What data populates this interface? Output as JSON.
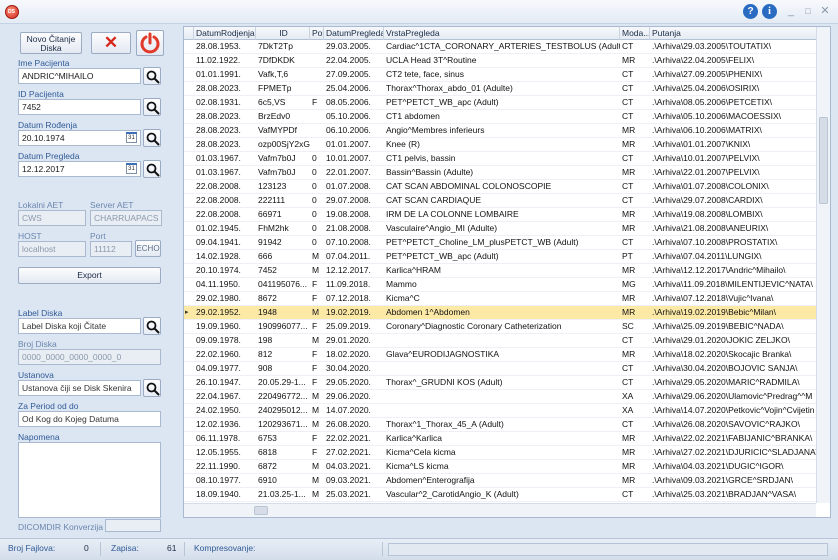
{
  "titlebar": {
    "logo_text": "DS",
    "help_label": "?",
    "info_label": "i",
    "minimize": "_",
    "maximize": "□",
    "close": "✕"
  },
  "left": {
    "new_reading_label": "Novo Čitanje\nDiska",
    "cancel_label": "✕",
    "patient_name_label": "Ime Pacijenta",
    "patient_name_value": "ANDRIC^MIHAILO",
    "patient_id_label": "ID Pacijenta",
    "patient_id_value": "7452",
    "birth_date_label": "Datum Rođenja",
    "birth_date_value": "20.10.1974",
    "exam_date_label": "Datum Pregleda",
    "exam_date_value": "12.12.2017",
    "cal_label": "31",
    "local_aet_label": "Lokalni AET",
    "server_aet_label": "Server AET",
    "local_aet_value": "CWS",
    "server_aet_value": "CHARRUAPACS",
    "host_label": "HOST",
    "port_label": "Port",
    "host_value": "localhost",
    "port_value": "11112",
    "echo_label": "ECHO",
    "export_label": "Export",
    "disk_label_label": "Label Diska",
    "disk_label_placeholder": "Label Diska koji Čitate",
    "disk_number_label": "Broj Diska",
    "disk_number_placeholder": "0000_0000_0000_0000_0",
    "institution_label": "Ustanova",
    "institution_placeholder": "Ustanova čiji se Disk Skenira",
    "period_label": "Za Period od do",
    "period_placeholder": "Od Kog do Kojeg Datuma",
    "note_label": "Napomena",
    "dicomdir_label": "DICOMDIR Konverzija"
  },
  "grid": {
    "columns": [
      "DatumRodjenja",
      "ID",
      "Pol",
      "DatumPregleda",
      "VrstaPregleda",
      "Moda...",
      "Putanja"
    ],
    "selected_index": 19,
    "selected_marker": "▸",
    "rows": [
      [
        "28.08.1953.",
        "7DkT2Tp",
        "",
        "29.03.2005.",
        "Cardiac^1CTA_CORONARY_ARTERIES_TESTBOLUS (Adult)",
        "CT",
        ".\\Arhiva\\29.03.2005\\TOUTATIX\\"
      ],
      [
        "11.02.1922.",
        "7DfDKDK",
        "",
        "22.04.2005.",
        "UCLA Head 3T^Routine",
        "MR",
        ".\\Arhiva\\22.04.2005\\FELIX\\"
      ],
      [
        "01.01.1991.",
        "Vafk,T,6",
        "",
        "27.09.2005.",
        "CT2 tete, face, sinus",
        "CT",
        ".\\Arhiva\\27.09.2005\\PHENIX\\"
      ],
      [
        "28.08.2023.",
        "FPMETp",
        "",
        "25.04.2006.",
        "Thorax^Thorax_abdo_01 (Adulte)",
        "CT",
        ".\\Arhiva\\25.04.2006\\OSIRIX\\"
      ],
      [
        "02.08.1931.",
        "6c5,VS",
        "F",
        "08.05.2006.",
        "PET^PETCT_WB_apc (Adult)",
        "CT",
        ".\\Arhiva\\08.05.2006\\PETCETIX\\"
      ],
      [
        "28.08.2023.",
        "BrzEdv0",
        "",
        "05.10.2006.",
        "CT1 abdomen",
        "CT",
        ".\\Arhiva\\05.10.2006\\MACOESSIX\\"
      ],
      [
        "28.08.2023.",
        "VafMYPDf",
        "",
        "06.10.2006.",
        "Angio^Membres inferieurs",
        "MR",
        ".\\Arhiva\\06.10.2006\\MATRIX\\"
      ],
      [
        "28.08.2023.",
        "ozp00SjY2xG",
        "",
        "01.01.2007.",
        "Knee (R)",
        "MR",
        ".\\Arhiva\\01.01.2007\\KNIX\\"
      ],
      [
        "01.03.1967.",
        "Vafm7b0J",
        "0",
        "10.01.2007.",
        "CT1 pelvis, bassin",
        "CT",
        ".\\Arhiva\\10.01.2007\\PELVIX\\"
      ],
      [
        "01.03.1967.",
        "Vafm7b0J",
        "0",
        "22.01.2007.",
        "Bassin^Bassin (Adulte)",
        "MR",
        ".\\Arhiva\\22.01.2007\\PELVIX\\"
      ],
      [
        "22.08.2008.",
        "123123",
        "0",
        "01.07.2008.",
        "CAT SCAN ABDOMINAL COLONOSCOPIE",
        "CT",
        ".\\Arhiva\\01.07.2008\\COLONIX\\"
      ],
      [
        "22.08.2008.",
        "222111",
        "0",
        "29.07.2008.",
        "CAT SCAN CARDIAQUE",
        "CT",
        ".\\Arhiva\\29.07.2008\\CARDIX\\"
      ],
      [
        "22.08.2008.",
        "66971",
        "0",
        "19.08.2008.",
        "IRM DE LA COLONNE LOMBAIRE",
        "MR",
        ".\\Arhiva\\19.08.2008\\LOMBIX\\"
      ],
      [
        "01.02.1945.",
        "FhM2hk",
        "0",
        "21.08.2008.",
        "Vasculaire^Angio_MI (Adulte)",
        "MR",
        ".\\Arhiva\\21.08.2008\\ANEURIX\\"
      ],
      [
        "09.04.1941.",
        "91942",
        "0",
        "07.10.2008.",
        "PET^PETCT_Choline_LM_plusPETCT_WB (Adult)",
        "CT",
        ".\\Arhiva\\07.10.2008\\PROSTATIX\\"
      ],
      [
        "14.02.1928.",
        "666",
        "M",
        "07.04.2011.",
        "PET^PETCT_WB_apc (Adult)",
        "PT",
        ".\\Arhiva\\07.04.2011\\LUNGIX\\"
      ],
      [
        "20.10.1974.",
        "7452",
        "M",
        "12.12.2017.",
        "Karlica^HRAM",
        "MR",
        ".\\Arhiva\\12.12.2017\\Andric^Mihailo\\"
      ],
      [
        "04.11.1950.",
        "041195076...",
        "F",
        "11.09.2018.",
        "Mammo",
        "MG",
        ".\\Arhiva\\11.09.2018\\MILENTIJEVIC^NATA\\"
      ],
      [
        "29.02.1980.",
        "8672",
        "F",
        "07.12.2018.",
        "Kicma^C",
        "MR",
        ".\\Arhiva\\07.12.2018\\Vujic^Ivana\\"
      ],
      [
        "29.02.1952.",
        "1948",
        "M",
        "19.02.2019.",
        "Abdomen 1^Abdomen",
        "MR",
        ".\\Arhiva\\19.02.2019\\Bebic^Milan\\"
      ],
      [
        "19.09.1960.",
        "190996077...",
        "F",
        "25.09.2019.",
        "Coronary^Diagnostic Coronary Catheterization",
        "SC",
        ".\\Arhiva\\25.09.2019\\BEBIC^NADA\\"
      ],
      [
        "09.09.1978.",
        "198",
        "M",
        "29.01.2020.",
        "",
        "CT",
        ".\\Arhiva\\29.01.2020\\JOKIC ZELJKO\\"
      ],
      [
        "22.02.1960.",
        "812",
        "F",
        "18.02.2020.",
        "Glava^EURODIJAGNOSTIKA",
        "MR",
        ".\\Arhiva\\18.02.2020\\Skocajic Branka\\"
      ],
      [
        "04.09.1977.",
        "908",
        "F",
        "30.04.2020.",
        "",
        "CT",
        ".\\Arhiva\\30.04.2020\\BOJOVIC SANJA\\"
      ],
      [
        "26.10.1947.",
        "20.05.29-1...",
        "F",
        "29.05.2020.",
        "Thorax^_GRUDNI KOS (Adult)",
        "CT",
        ".\\Arhiva\\29.05.2020\\MARIC^RADMILA\\"
      ],
      [
        "22.04.1967.",
        "220496772...",
        "M",
        "29.06.2020.",
        "",
        "XA",
        ".\\Arhiva\\29.06.2020\\Ulamovic^Predrag^^M"
      ],
      [
        "24.02.1950.",
        "240295012...",
        "M",
        "14.07.2020.",
        "",
        "XA",
        ".\\Arhiva\\14.07.2020\\Petkovic^Vojin^Cvijetin"
      ],
      [
        "12.02.1936.",
        "120293671...",
        "M",
        "26.08.2020.",
        "Thorax^1_Thorax_45_A (Adult)",
        "CT",
        ".\\Arhiva\\26.08.2020\\SAVOVIC^RAJKO\\"
      ],
      [
        "06.11.1978.",
        "6753",
        "F",
        "22.02.2021.",
        "Karlica^Karlica",
        "MR",
        ".\\Arhiva\\22.02.2021\\FABIJANIC^BRANKA\\"
      ],
      [
        "12.05.1955.",
        "6818",
        "F",
        "27.02.2021.",
        "Kicma^Cela kicma",
        "MR",
        ".\\Arhiva\\27.02.2021\\DJURICIC^SLADJANA\\"
      ],
      [
        "22.11.1990.",
        "6872",
        "M",
        "04.03.2021.",
        "Kicma^LS kicma",
        "MR",
        ".\\Arhiva\\04.03.2021\\DUGIC^IGOR\\"
      ],
      [
        "08.10.1977.",
        "6910",
        "M",
        "09.03.2021.",
        "Abdomen^Enterografija",
        "MR",
        ".\\Arhiva\\09.03.2021\\GRCE^SRDJAN\\"
      ],
      [
        "18.09.1940.",
        "21.03.25-1...",
        "M",
        "25.03.2021.",
        "Vascular^2_CarotidAngio_K (Adult)",
        "CT",
        ".\\Arhiva\\25.03.2021\\BRADJAN^VASA\\"
      ]
    ]
  },
  "status": {
    "files_label": "Broj Fajlova:",
    "files_value": "0",
    "records_label": "Zapisa:",
    "records_value": "61",
    "compress_label": "Kompresovanje:"
  },
  "colors": {
    "accent": "#2f5a96",
    "selected_row": "#fde9a6",
    "power": "#e23a2a"
  },
  "icons": [
    "app-logo",
    "help-icon",
    "info-icon",
    "close-x-icon",
    "power-icon",
    "search-icon",
    "calendar-icon"
  ]
}
